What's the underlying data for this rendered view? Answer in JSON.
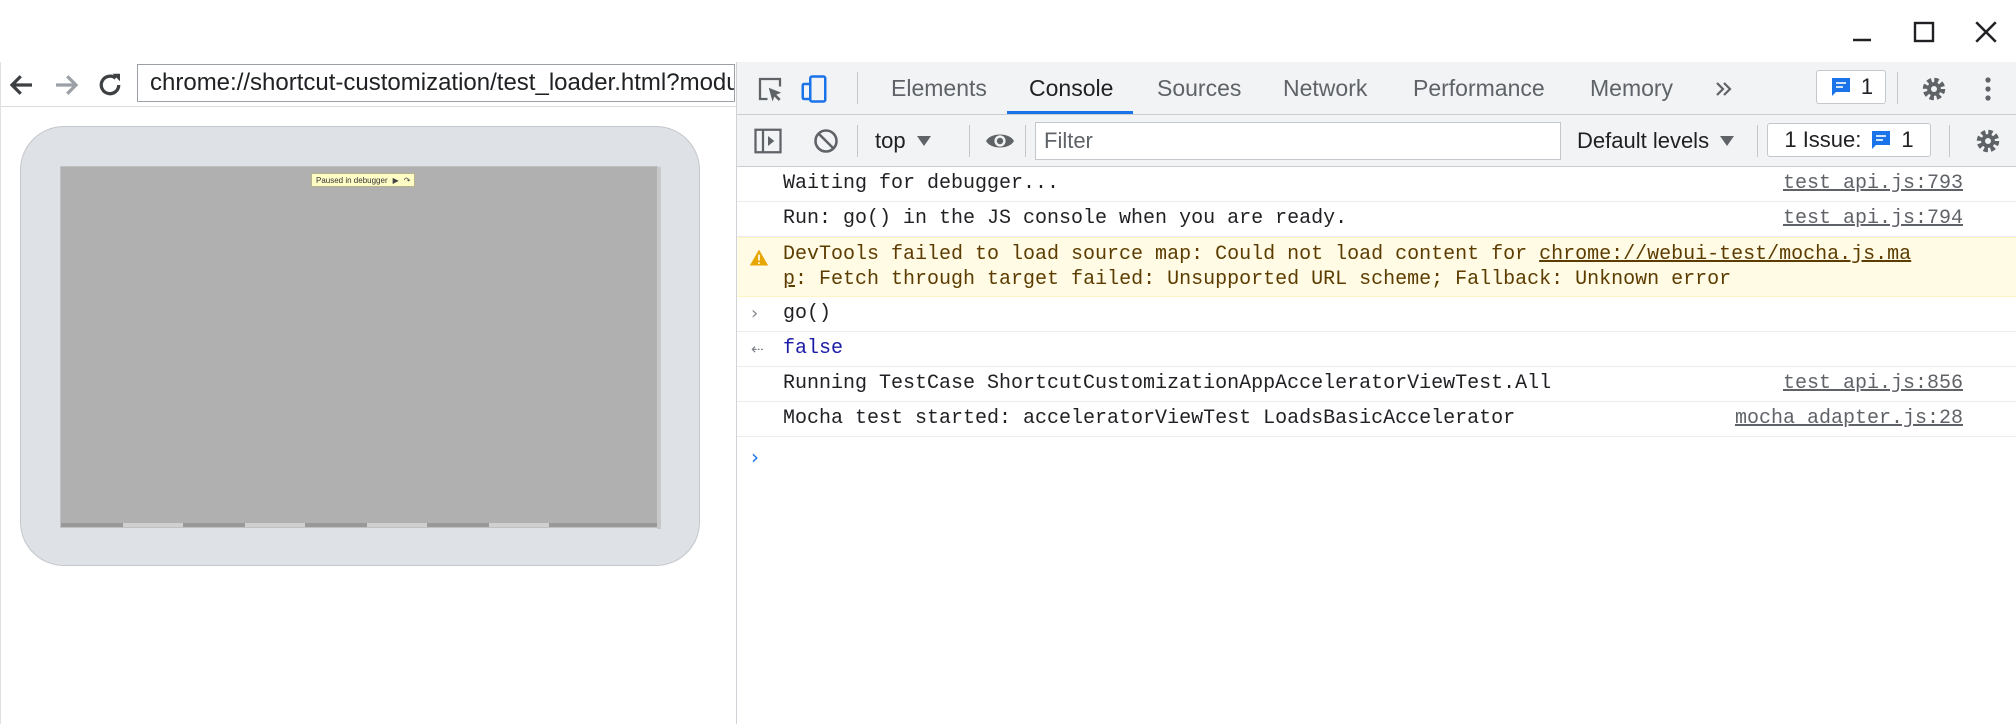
{
  "window": {
    "minimize_icon": "minimize-icon",
    "maximize_icon": "maximize-icon",
    "close_icon": "close-icon"
  },
  "browser": {
    "url": "chrome://shortcut-customization/test_loader.html?module=chromeos/shortcut_customization/shortcut_customization_test.js",
    "paused_label": "Paused in debugger"
  },
  "devtools": {
    "tabs": [
      {
        "label": "Elements",
        "active": false
      },
      {
        "label": "Console",
        "active": true
      },
      {
        "label": "Sources",
        "active": false
      },
      {
        "label": "Network",
        "active": false
      },
      {
        "label": "Performance",
        "active": false
      },
      {
        "label": "Memory",
        "active": false
      }
    ],
    "messages_count": "1",
    "toolbar": {
      "context": "top",
      "filter_placeholder": "Filter",
      "levels": "Default levels",
      "issues_label": "1 Issue:",
      "issues_count": "1"
    },
    "console": [
      {
        "text": "Waiting for debugger...",
        "source": "test_api.js:793"
      },
      {
        "text": "Run: go() in the JS console when you are ready.",
        "source": "test_api.js:794"
      },
      {
        "warn_prefix": "DevTools failed to load source map: Could not load content for ",
        "warn_link_1": "chrome://webui-test/mocha.js.ma",
        "warn_link_2": "p",
        "warn_suffix": ": Fetch through target failed: Unsupported URL scheme; Fallback: Unknown error"
      },
      {
        "input": "go()"
      },
      {
        "result": "false"
      },
      {
        "text": "Running TestCase ShortcutCustomizationAppAcceleratorViewTest.All",
        "source": "test_api.js:856"
      },
      {
        "text": "Mocha test started: acceleratorViewTest LoadsBasicAccelerator",
        "source": "mocha_adapter.js:28"
      }
    ]
  }
}
